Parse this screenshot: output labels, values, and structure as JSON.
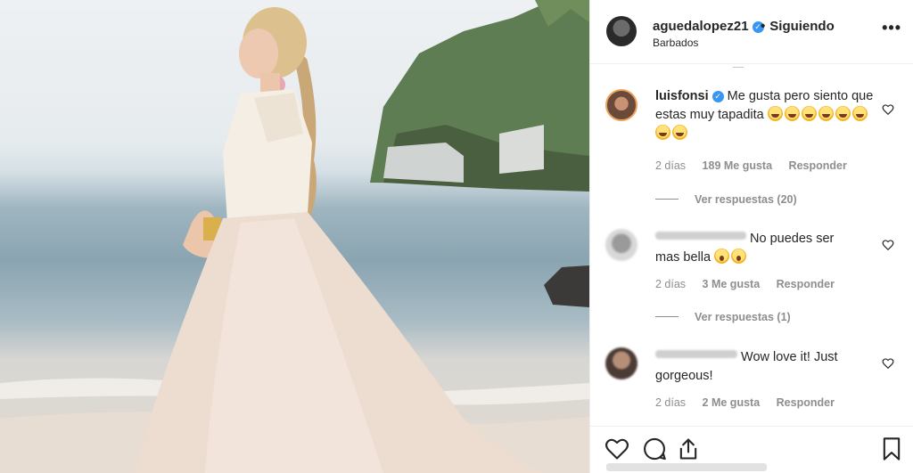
{
  "post": {
    "author": {
      "username": "aguedalopez21",
      "verified_icon": "verified-badge-icon",
      "follow_status": "Siguiendo",
      "location": "Barbados"
    },
    "more_icon": "more-options-icon"
  },
  "comments": [
    {
      "username": "luisfonsi",
      "verified": true,
      "text": "Me gusta pero siento que estas muy tapadita",
      "emoji_count": 8,
      "time": "2 días",
      "likes": "189 Me gusta",
      "reply_label": "Responder",
      "view_replies": "Ver respuestas (20)"
    },
    {
      "username_hidden": true,
      "text_line1": "No puedes ser",
      "text_line2": "mas bella",
      "emoji_count": 2,
      "time": "2 días",
      "likes": "3 Me gusta",
      "reply_label": "Responder",
      "view_replies": "Ver respuestas (1)"
    },
    {
      "username_hidden": true,
      "text_line1": "Wow love it! Just",
      "text_line2": "gorgeous!",
      "time": "2 días",
      "likes": "2 Me gusta",
      "reply_label": "Responder"
    }
  ],
  "actions": {
    "like_icon": "heart-icon",
    "comment_icon": "comment-icon",
    "share_icon": "share-icon",
    "save_icon": "bookmark-icon"
  },
  "colors": {
    "verified": "#3897f0",
    "muted": "#8e8e8e",
    "text": "#262626",
    "divider": "#efefef"
  }
}
